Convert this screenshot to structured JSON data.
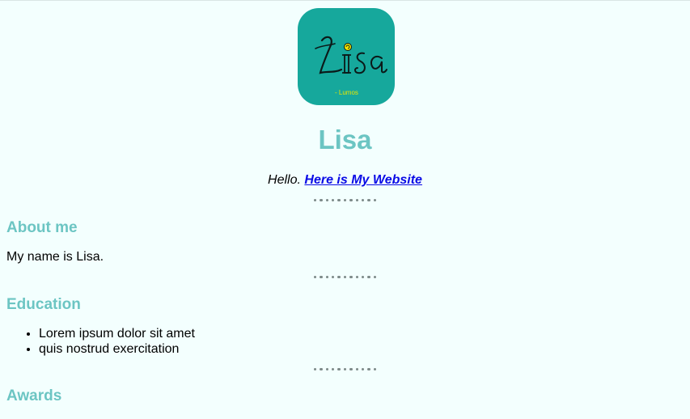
{
  "header": {
    "logo_text": "Lisa",
    "logo_subtext": "- Lumos",
    "title": "Lisa",
    "tagline_prefix": "Hello.",
    "tagline_link": "Here is My Website"
  },
  "sections": {
    "about": {
      "heading": "About me",
      "text": "My name is Lisa."
    },
    "education": {
      "heading": "Education",
      "items": [
        "Lorem ipsum dolor sit amet",
        "quis nostrud exercitation"
      ]
    },
    "awards": {
      "heading": "Awards"
    }
  },
  "colors": {
    "background": "#f3fffe",
    "heading": "#6cc5c3",
    "logo_background": "#16a89c",
    "link": "#0a0ae6",
    "logo_subtext": "#e8e600"
  }
}
